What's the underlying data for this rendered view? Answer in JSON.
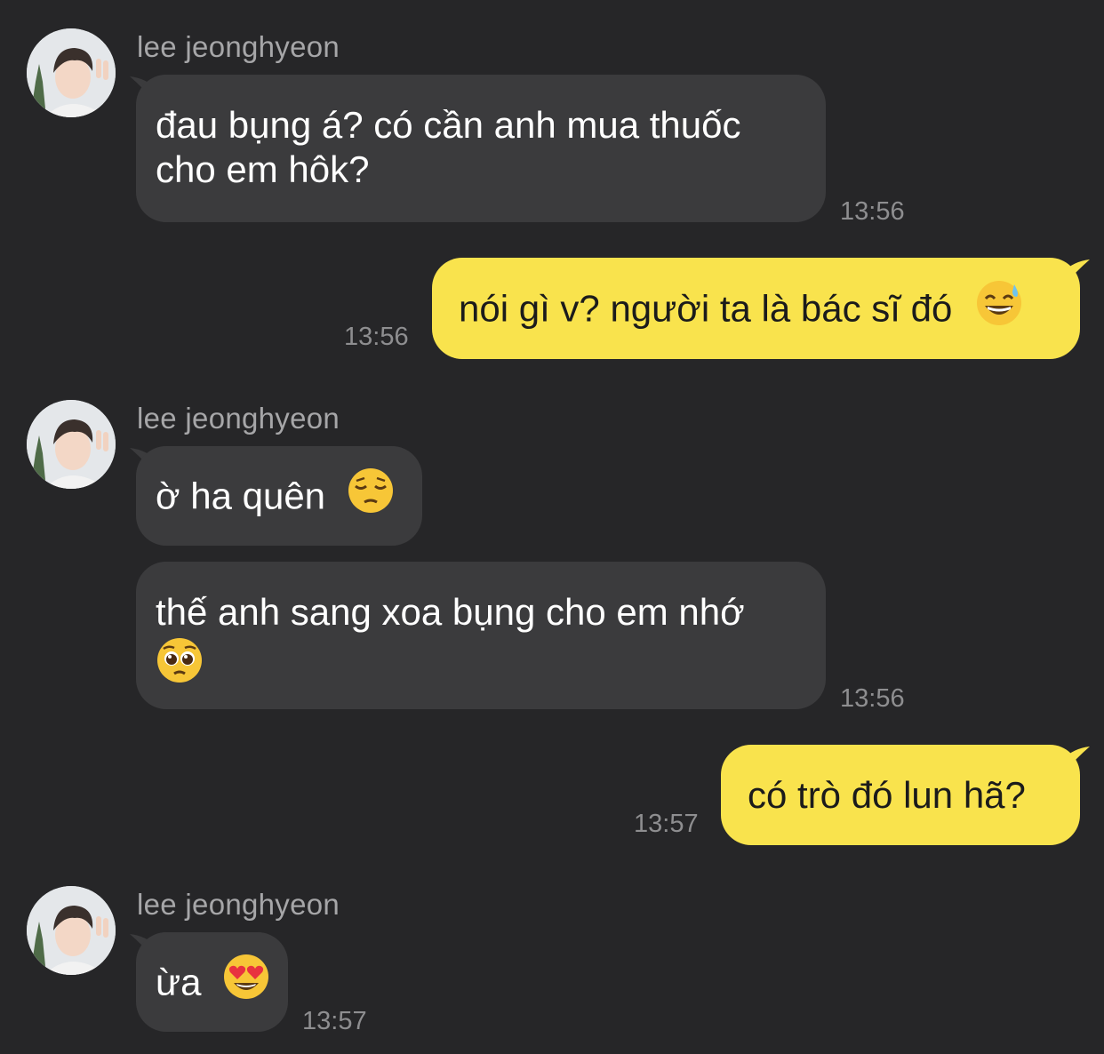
{
  "chat": {
    "contact_name": "lee jeonghyeon",
    "colors": {
      "background": "#262628",
      "incoming_bubble": "#3b3b3d",
      "outgoing_bubble": "#f9e34d",
      "timestamp": "#8e8e90",
      "sender_name": "#a6a6a8"
    },
    "messages": [
      {
        "direction": "incoming",
        "sender": "lee jeonghyeon",
        "lines": [
          "đau bụng á? có cần anh mua thuốc",
          "cho em hôk?"
        ],
        "time": "13:56"
      },
      {
        "direction": "outgoing",
        "text": "nói gì v? người ta là bác sĩ đó",
        "emoji": "grinning-sweat-emoji",
        "time": "13:56"
      },
      {
        "direction": "incoming",
        "sender": "lee jeonghyeon",
        "text": "ờ ha quên",
        "emoji": "pensive-face-emoji"
      },
      {
        "direction": "incoming",
        "lines": [
          "thế anh sang xoa bụng cho em nhớ"
        ],
        "emoji": "pleading-face-emoji",
        "time": "13:56"
      },
      {
        "direction": "outgoing",
        "text": "có trò đó lun hã?",
        "time": "13:57"
      },
      {
        "direction": "incoming",
        "sender": "lee jeonghyeon",
        "text": "ừa",
        "emoji": "heart-eyes-emoji",
        "time": "13:57"
      }
    ]
  }
}
